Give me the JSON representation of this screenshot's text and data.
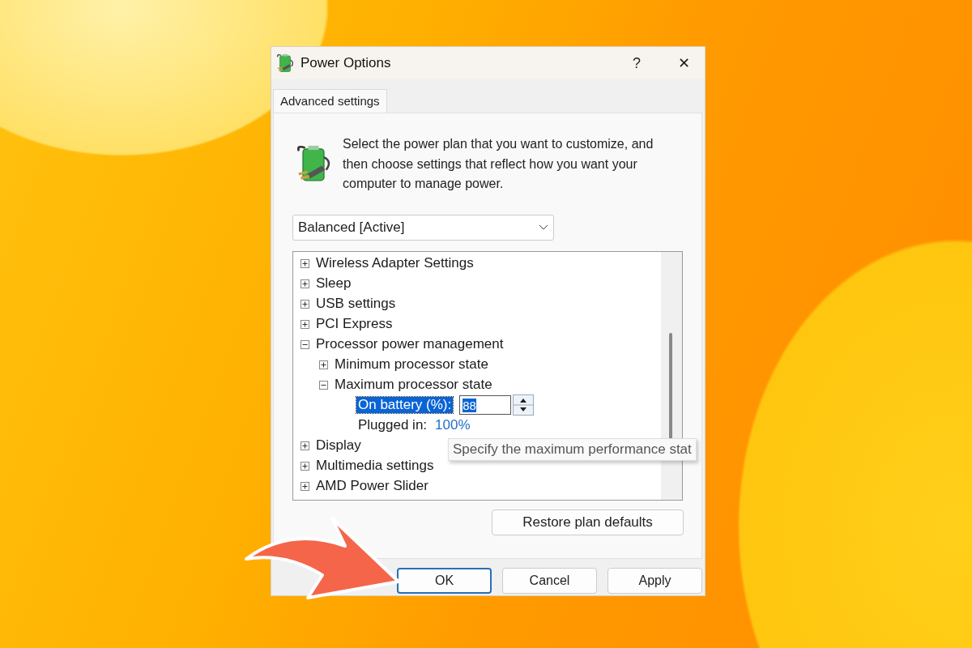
{
  "window": {
    "title": "Power Options",
    "help": "?",
    "close": "✕"
  },
  "tabs": [
    {
      "label": "Advanced settings",
      "selected": true
    }
  ],
  "intro": "Select the power plan that you want to customize, and then choose settings that reflect how you want your computer to manage power.",
  "plan_dropdown": {
    "value": "Balanced [Active]"
  },
  "tree": {
    "items": [
      {
        "label": "Wireless Adapter Settings",
        "expanded": false
      },
      {
        "label": "Sleep",
        "expanded": false
      },
      {
        "label": "USB settings",
        "expanded": false
      },
      {
        "label": "PCI Express",
        "expanded": false
      },
      {
        "label": "Processor power management",
        "expanded": true,
        "children": [
          {
            "label": "Minimum processor state",
            "expanded": false
          },
          {
            "label": "Maximum processor state",
            "expanded": true,
            "children": [
              {
                "kind": "spin",
                "label": "On battery (%):",
                "value": "88",
                "selected": true
              },
              {
                "kind": "value",
                "label": "Plugged in:",
                "value": "100%",
                "selected": false
              }
            ]
          }
        ]
      },
      {
        "label": "Display",
        "expanded": false
      },
      {
        "label": "Multimedia settings",
        "expanded": false
      },
      {
        "label": "AMD Power Slider",
        "expanded": false
      }
    ]
  },
  "tooltip": {
    "text": "Specify the maximum performance stat"
  },
  "restore_button": {
    "label": "Restore plan defaults"
  },
  "buttons": [
    {
      "label": "OK",
      "default": true
    },
    {
      "label": "Cancel",
      "default": false
    },
    {
      "label": "Apply",
      "default": false
    }
  ]
}
